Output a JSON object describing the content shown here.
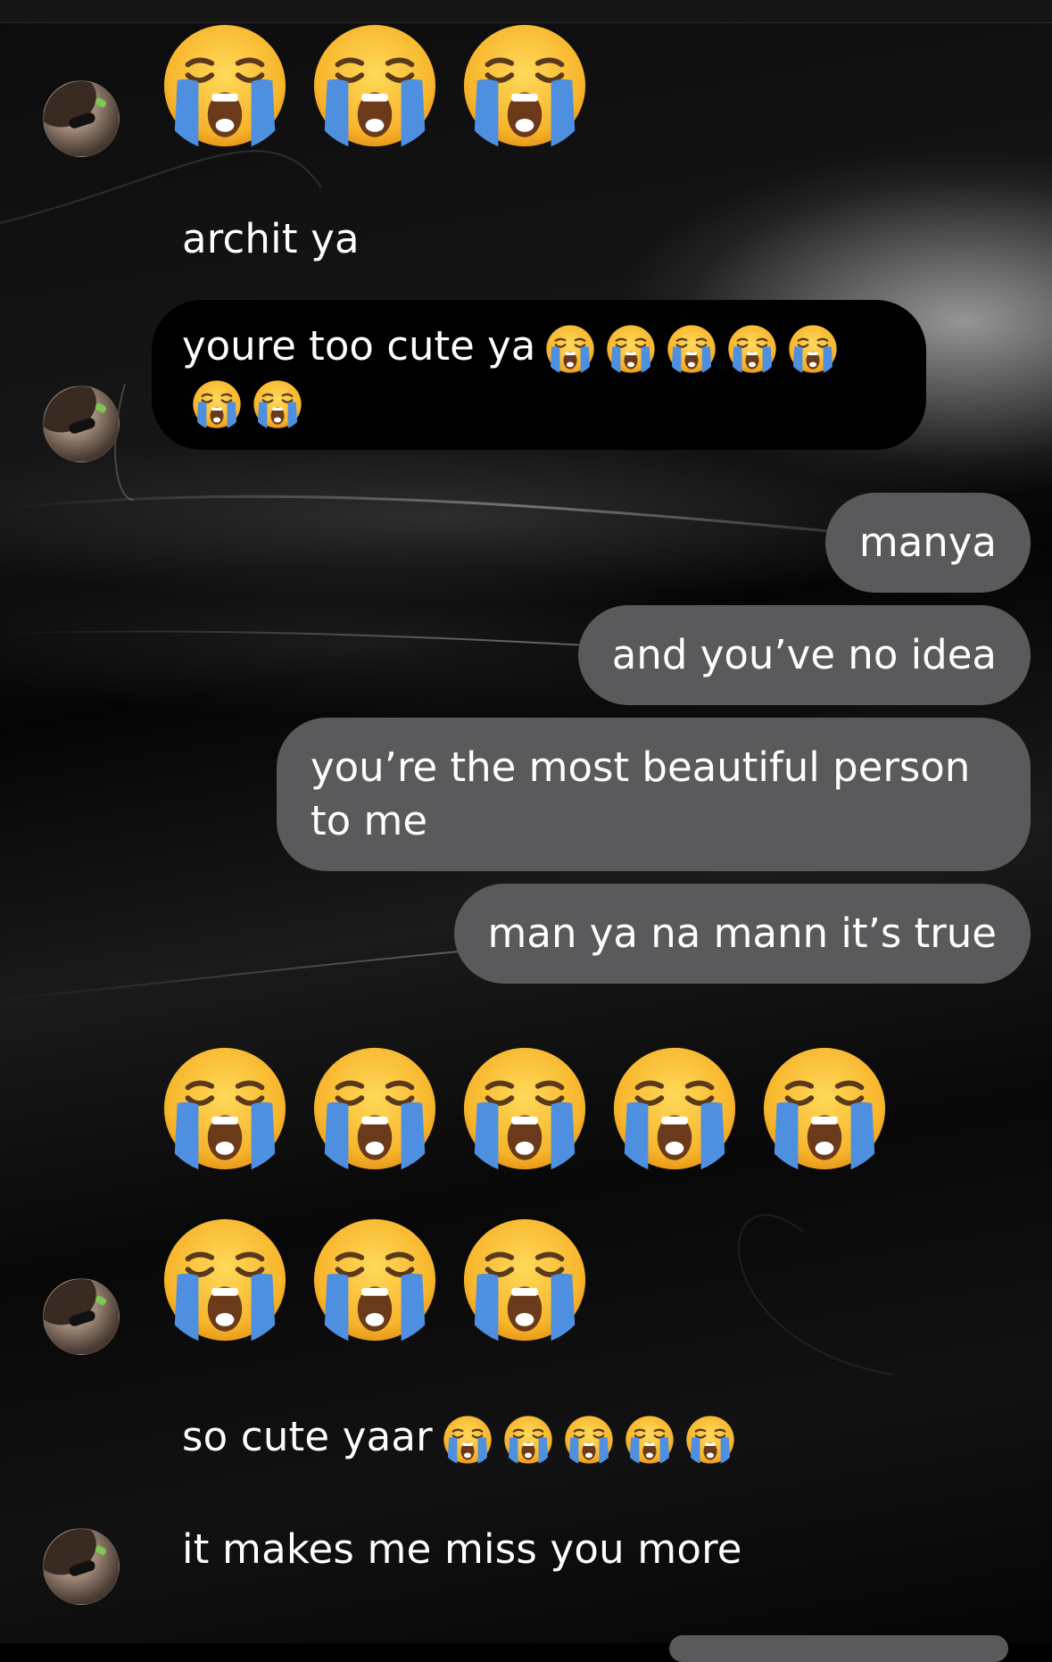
{
  "chat": {
    "messages": [
      {
        "id": "m1",
        "from": "them",
        "type": "emoji",
        "emoji_count": 3,
        "icon": "loudly-crying-face"
      },
      {
        "id": "m2",
        "from": "them",
        "text": "archit ya"
      },
      {
        "id": "m3",
        "from": "them",
        "text": "youre too cute ya",
        "trailing_emoji_count": 7,
        "icon": "loudly-crying-face"
      },
      {
        "id": "m4",
        "from": "me",
        "text": "manya"
      },
      {
        "id": "m5",
        "from": "me",
        "text": "and you’ve no idea"
      },
      {
        "id": "m6",
        "from": "me",
        "text": "you’re the most beautiful person to me"
      },
      {
        "id": "m7",
        "from": "me",
        "text": "man ya na mann it’s true"
      },
      {
        "id": "m8",
        "from": "them",
        "type": "emoji",
        "emoji_count": 8,
        "icon": "loudly-crying-face"
      },
      {
        "id": "m9",
        "from": "them",
        "text": "so cute yaar",
        "trailing_emoji_count": 5,
        "icon": "loudly-crying-face"
      },
      {
        "id": "m10",
        "from": "them",
        "text": "it makes me miss you more"
      }
    ]
  },
  "colors": {
    "outgoing_bubble": "#5a5a5c",
    "incoming_bubble": "#000000",
    "text": "#ffffff",
    "background": "#000000"
  }
}
